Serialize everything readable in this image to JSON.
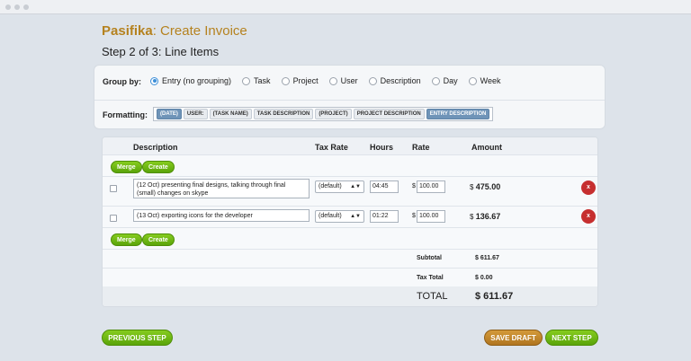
{
  "header": {
    "brand": "Pasifika",
    "page_title": ": Create Invoice",
    "step": "Step 2 of 3: Line Items"
  },
  "group_by": {
    "label": "Group by:",
    "options": [
      {
        "label": "Entry (no grouping)",
        "selected": true
      },
      {
        "label": "Task",
        "selected": false
      },
      {
        "label": "Project",
        "selected": false
      },
      {
        "label": "User",
        "selected": false
      },
      {
        "label": "Description",
        "selected": false
      },
      {
        "label": "Day",
        "selected": false
      },
      {
        "label": "Week",
        "selected": false
      }
    ]
  },
  "formatting": {
    "label": "Formatting:",
    "tokens": [
      "(DATE)",
      "USER:",
      "(TASK NAME)",
      "TASK DESCRIPTION",
      "(PROJECT)",
      "PROJECT DESCRIPTION",
      "ENTRY DESCRIPTION"
    ]
  },
  "table": {
    "columns": {
      "description": "Description",
      "tax_rate": "Tax Rate",
      "hours": "Hours",
      "rate": "Rate",
      "amount": "Amount"
    },
    "merge_label": "Merge",
    "create_label": "Create",
    "currency": "$",
    "delete_label": "x",
    "rows": [
      {
        "description": "(12 Oct) presenting final designs, talking through final (small) changes on skype",
        "tax": "(default)",
        "hours": "04:45",
        "rate": "100.00",
        "amount": "475.00"
      },
      {
        "description": "(13 Oct) exporting icons for the developer",
        "tax": "(default)",
        "hours": "01:22",
        "rate": "100.00",
        "amount": "136.67"
      }
    ]
  },
  "totals": {
    "subtotal_label": "Subtotal",
    "subtotal_value": "$ 611.67",
    "tax_label": "Tax Total",
    "tax_value": "$ 0.00",
    "total_label": "TOTAL",
    "total_value": "$ 611.67"
  },
  "footer": {
    "previous": "PREVIOUS STEP",
    "save_draft": "SAVE DRAFT",
    "next": "NEXT STEP"
  },
  "colors": {
    "brand": "#b5821f",
    "accent_green": "#6ab515",
    "delete_red": "#c62f2f",
    "draft_orange": "#c48a2f"
  }
}
